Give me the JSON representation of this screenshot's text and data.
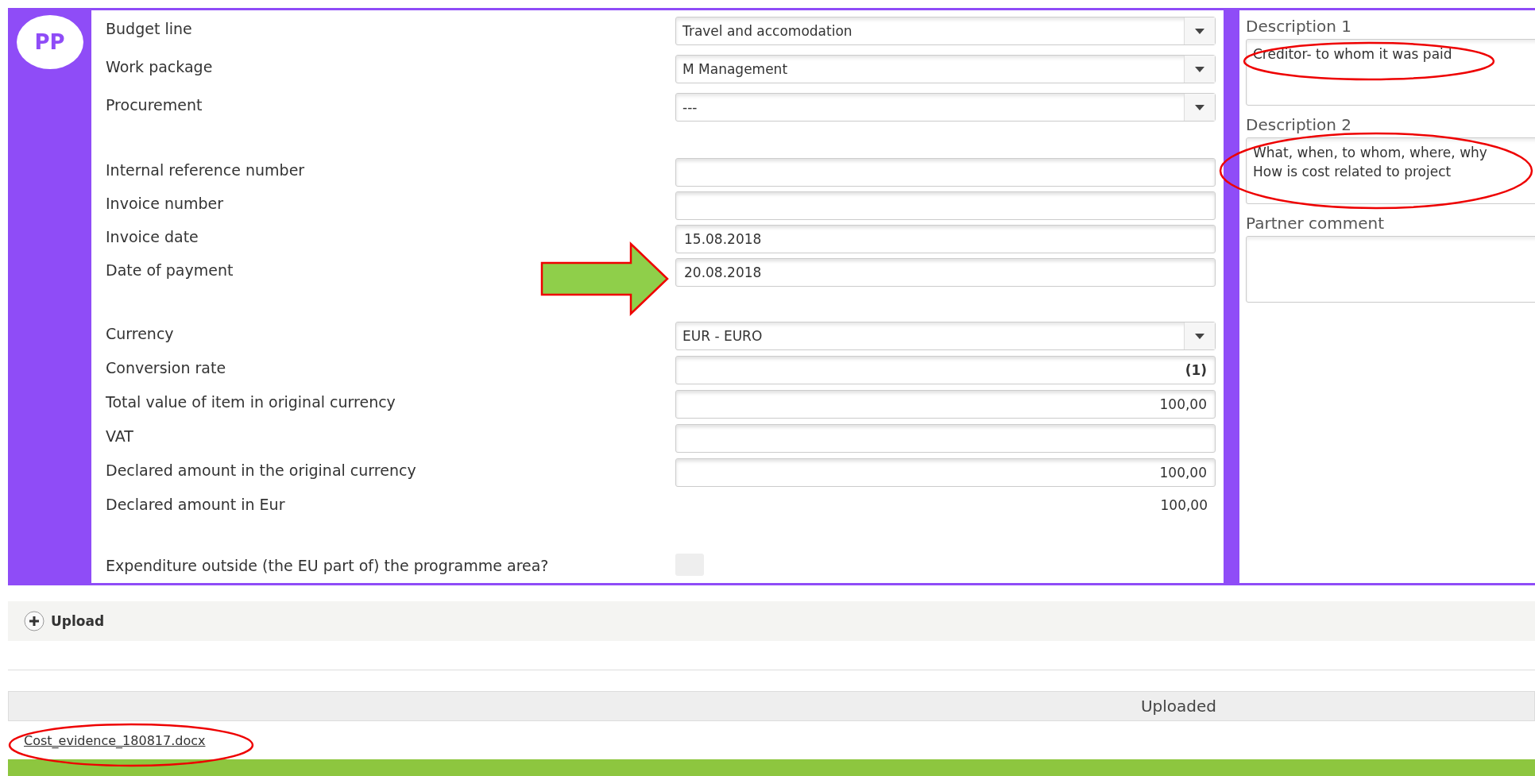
{
  "avatar": {
    "initials": "PP"
  },
  "form": {
    "groups": [
      {
        "rows": [
          {
            "label": "Budget line",
            "kind": "select",
            "value": "Travel and accomodation"
          },
          {
            "label": "Work package",
            "kind": "select",
            "value": "M Management"
          },
          {
            "label": "Procurement",
            "kind": "select",
            "value": "---"
          }
        ]
      },
      {
        "rows": [
          {
            "label": "Internal reference number",
            "kind": "text"
          },
          {
            "label": "Invoice number",
            "kind": "text"
          },
          {
            "label": "Invoice date",
            "kind": "text",
            "value": "15.08.2018"
          },
          {
            "label": "Date of payment",
            "kind": "text",
            "value": "20.08.2018"
          }
        ]
      },
      {
        "rows": [
          {
            "label": "Currency",
            "kind": "select",
            "value": "EUR - EURO"
          },
          {
            "label": "Conversion rate",
            "kind": "number",
            "value": "(1)"
          },
          {
            "label": "Total value of item in original currency",
            "kind": "number",
            "value": "100,00"
          },
          {
            "label": "VAT",
            "kind": "number"
          },
          {
            "label": "Declared amount in the original currency",
            "kind": "number",
            "value": "100,00"
          },
          {
            "label": "Declared amount in Eur",
            "kind": "readonly",
            "value": "100,00"
          }
        ]
      },
      {
        "rows": [
          {
            "label": "Expenditure outside (the EU part of) the programme area?",
            "kind": "checkbox",
            "checked": false
          }
        ]
      }
    ]
  },
  "notes": [
    {
      "label": "Description 1",
      "lines": [
        "Creditor- to whom it was paid"
      ]
    },
    {
      "label": "Description 2",
      "lines": [
        "What, when, to whom, where, why",
        "How is cost related to project"
      ]
    },
    {
      "label": "Partner comment"
    }
  ],
  "upload": {
    "label": "Upload"
  },
  "uploaded": {
    "header": "Uploaded",
    "files": [
      "Cost_evidence_180817.docx"
    ]
  }
}
